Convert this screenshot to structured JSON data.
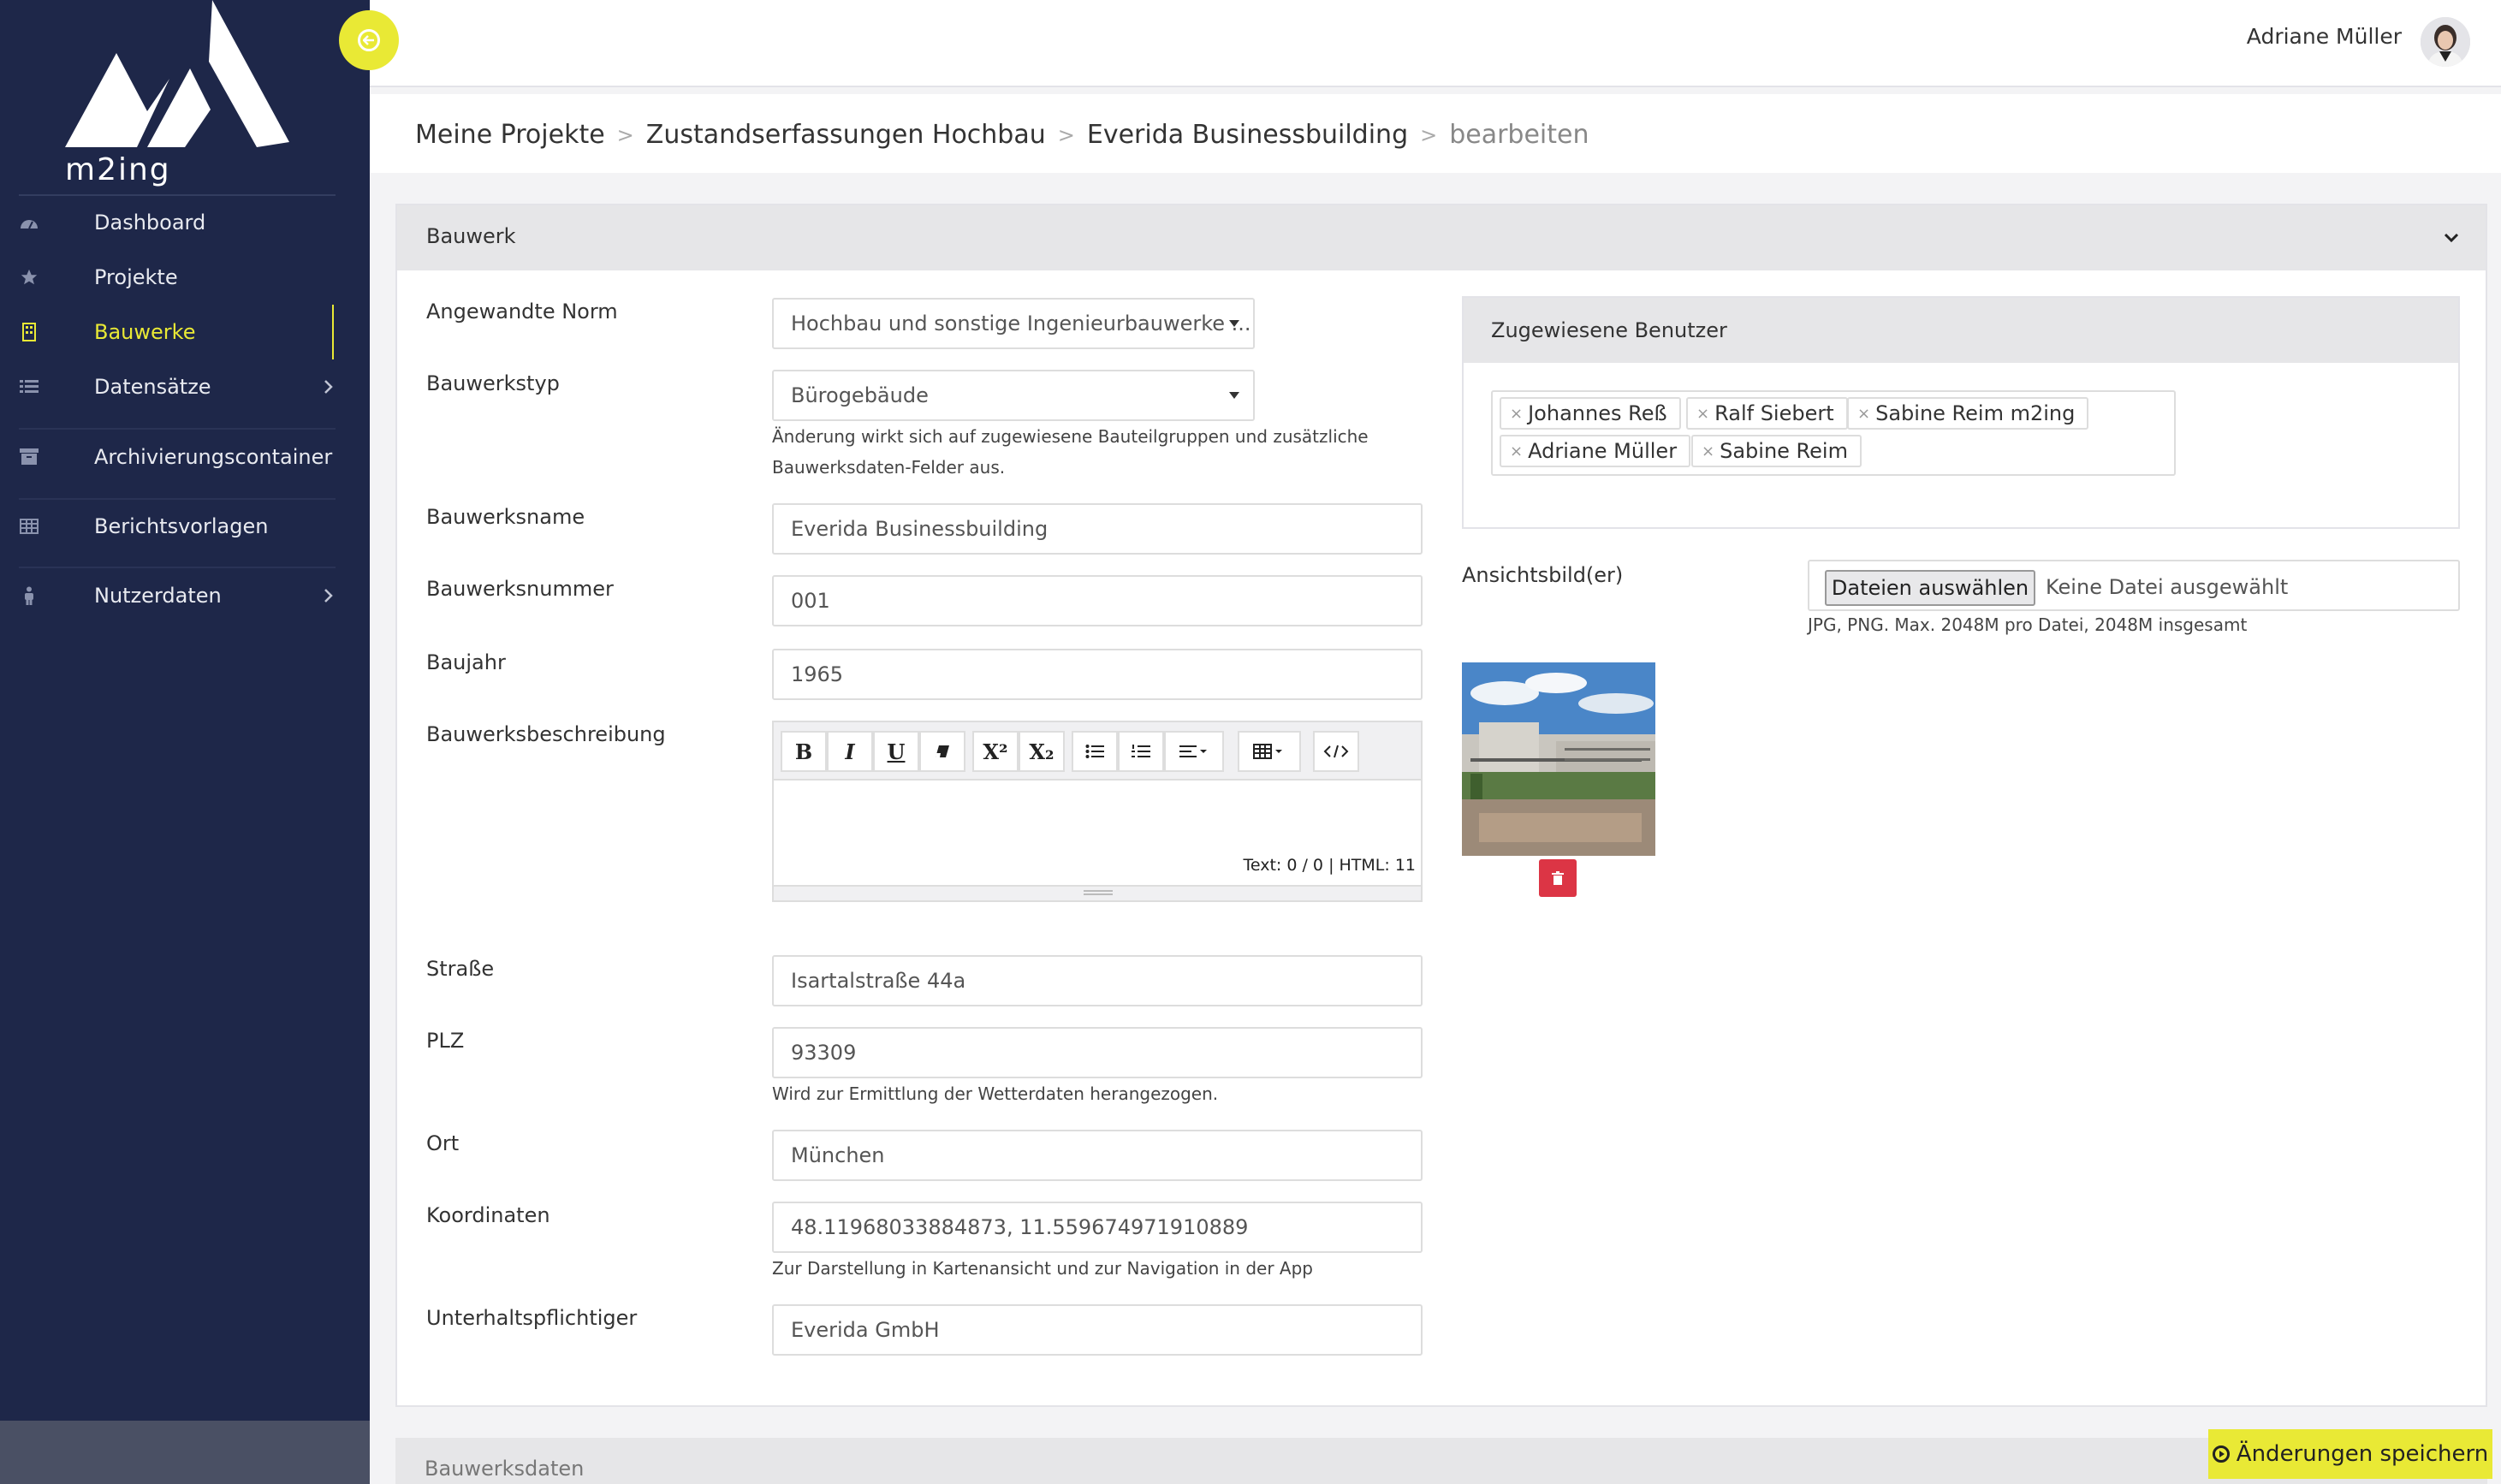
{
  "brand": {
    "logo_text": "m2ing",
    "accent_color": "#e9e935",
    "sidebar_color": "#1e2749"
  },
  "sidebar": {
    "items": [
      {
        "label": "Dashboard",
        "icon": "dashboard-icon"
      },
      {
        "label": "Projekte",
        "icon": "star-icon"
      },
      {
        "label": "Bauwerke",
        "icon": "building-icon",
        "active": true
      },
      {
        "label": "Datensätze",
        "icon": "list-icon",
        "has_submenu": true
      },
      {
        "label": "Archivierungscontainer",
        "icon": "archive-icon"
      },
      {
        "label": "Berichtsvorlagen",
        "icon": "table-icon"
      },
      {
        "label": "Nutzerdaten",
        "icon": "user-icon",
        "has_submenu": true
      }
    ]
  },
  "topbar": {
    "user_name": "Adriane Müller"
  },
  "breadcrumb": [
    "Meine Projekte",
    "Zustandserfassungen Hochbau",
    "Everida Businessbuilding",
    "bearbeiten"
  ],
  "breadcrumb_separator": ">",
  "card": {
    "title": "Bauwerk",
    "fields": {
      "norm": {
        "label": "Angewandte Norm",
        "value": "Hochbau und sonstige Ingenieurbauwerke ..."
      },
      "typ": {
        "label": "Bauwerkstyp",
        "value": "Bürogebäude",
        "help_line1": "Änderung wirkt sich auf zugewiesene Bauteilgruppen und zusätzliche",
        "help_line2": "Bauwerksdaten-Felder aus."
      },
      "name": {
        "label": "Bauwerksname",
        "value": "Everida Businessbuilding"
      },
      "nummer": {
        "label": "Bauwerksnummer",
        "value": "001"
      },
      "baujahr": {
        "label": "Baujahr",
        "value": "1965"
      },
      "beschreibung": {
        "label": "Bauwerksbeschreibung",
        "status": "Text: 0 / 0 | HTML: 11"
      },
      "strasse": {
        "label": "Straße",
        "value": "Isartalstraße 44a"
      },
      "plz": {
        "label": "PLZ",
        "value": "93309",
        "help": "Wird zur Ermittlung der Wetterdaten herangezogen."
      },
      "ort": {
        "label": "Ort",
        "value": "München"
      },
      "koordinaten": {
        "label": "Koordinaten",
        "value": "48.11968033884873, 11.559674971910889",
        "help": "Zur Darstellung in Kartenansicht und zur Navigation in der App"
      },
      "unterhalt": {
        "label": "Unterhaltspflichtiger",
        "value": "Everida GmbH"
      }
    },
    "editor_toolbar": {
      "bold": "B",
      "italic": "I",
      "underline": "U",
      "superscript": "X²",
      "subscript": "X₂"
    },
    "users": {
      "title": "Zugewiesene Benutzer",
      "tags": [
        "Johannes Reß",
        "Ralf Siebert",
        "Sabine Reim m2ing",
        "Adriane Müller",
        "Sabine Reim"
      ],
      "remove_symbol": "×"
    },
    "images": {
      "label": "Ansichtsbild(er)",
      "button": "Dateien auswählen",
      "no_file": "Keine Datei ausgewählt",
      "help": "JPG, PNG. Max. 2048M pro Datei, 2048M insgesamt"
    }
  },
  "card2": {
    "title": "Bauwerksdaten"
  },
  "save_button": "Änderungen speichern"
}
